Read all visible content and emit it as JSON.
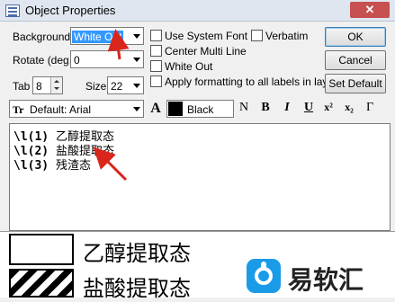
{
  "window": {
    "title": "Object Properties",
    "close_label": "✕"
  },
  "background": {
    "label": "Background",
    "value": "White Out"
  },
  "rotate": {
    "label": "Rotate (deg.)",
    "value": "0"
  },
  "tab": {
    "label": "Tab",
    "value": "8"
  },
  "size": {
    "label": "Size",
    "value": "22"
  },
  "checkboxes": {
    "use_system_font": "Use System Font",
    "center_multi_line": "Center Multi Line",
    "white_out": "White Out",
    "apply_all": "Apply formatting to all labels in layer",
    "verbatim": "Verbatim"
  },
  "buttons": {
    "ok": "OK",
    "cancel": "Cancel",
    "set_default": "Set Default"
  },
  "font": {
    "glyph": "Tr",
    "value": "Default: Arial"
  },
  "color": {
    "glyph": "A",
    "value": "Black",
    "swatch": "#000000"
  },
  "format": {
    "normal": "N",
    "bold": "B",
    "italic": "I",
    "underline": "U",
    "superscript": "x²",
    "subscript": "x₂",
    "greek": "Γ"
  },
  "editor": {
    "lines": [
      {
        "code": "\\l(1)",
        "text": " 乙醇提取态"
      },
      {
        "code": "\\l(2)",
        "text": " 盐酸提取态"
      },
      {
        "code": "\\l(3)",
        "text": " 残渣态"
      }
    ]
  },
  "preview": {
    "line1": "乙醇提取态",
    "line2": "盐酸提取态"
  },
  "watermark": {
    "text": "易软汇"
  }
}
